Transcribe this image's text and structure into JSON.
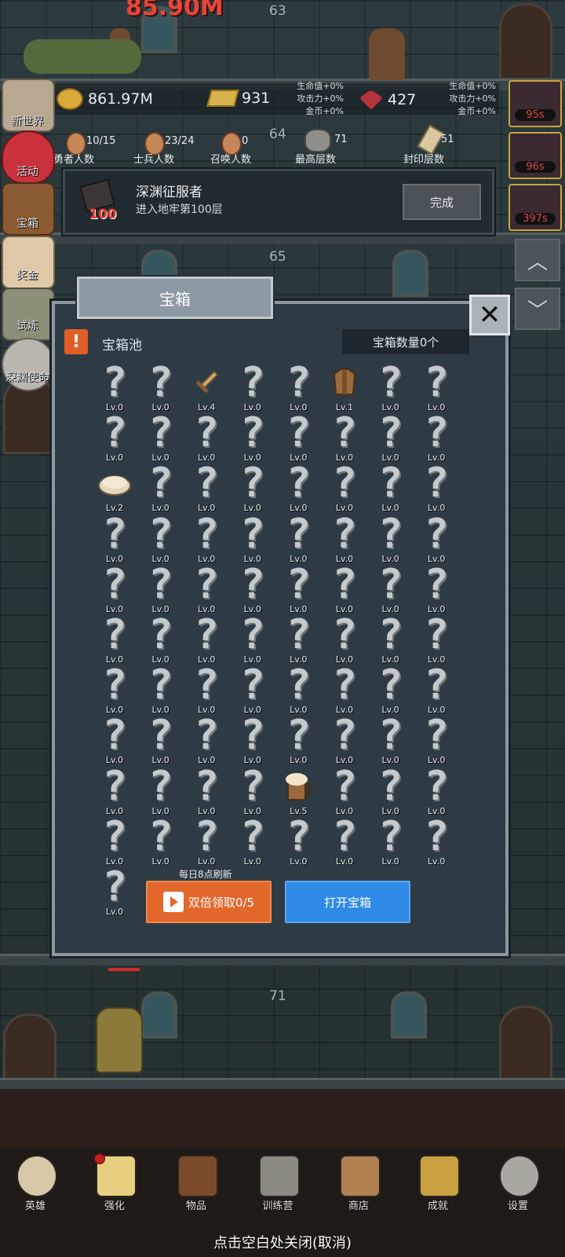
{
  "top_banner": {
    "damage_text": "85.90M"
  },
  "floors": [
    "63",
    "64",
    "65",
    "71"
  ],
  "resources": {
    "gold": "861.97M",
    "gold_bar": "931",
    "gem": "427",
    "bonus_left": [
      "生命值+0%",
      "攻击力+0%",
      "金币+0%"
    ],
    "bonus_right": [
      "生命值+0%",
      "攻击力+0%",
      "金币+0%"
    ]
  },
  "timers": [
    "95s",
    "96s",
    "397s"
  ],
  "stats": [
    {
      "value": "10/15",
      "label": "勇者人数"
    },
    {
      "value": "23/24",
      "label": "士兵人数"
    },
    {
      "value": "0",
      "label": "召唤人数"
    },
    {
      "value": "71",
      "label": "最高层数"
    },
    {
      "value": "51",
      "label": "封印层数"
    }
  ],
  "side_menu": [
    "新世界",
    "活动",
    "宝箱",
    "奖金",
    "试炼",
    "深渊使命"
  ],
  "quest": {
    "level_badge": "100",
    "title": "深渊征服者",
    "desc": "进入地牢第100层",
    "button": "完成"
  },
  "panel": {
    "title": "宝箱",
    "pool_label": "宝箱池",
    "count_label": "宝箱数量0个",
    "close_icon": "close-x-icon",
    "refresh_note": "每日8点刷新",
    "double_button": "双倍领取0/5",
    "open_button": "打开宝箱",
    "items": [
      {
        "lv": "Lv.0",
        "icon": "unknown"
      },
      {
        "lv": "Lv.0",
        "icon": "unknown"
      },
      {
        "lv": "Lv.4",
        "icon": "sword"
      },
      {
        "lv": "Lv.0",
        "icon": "unknown"
      },
      {
        "lv": "Lv.0",
        "icon": "unknown"
      },
      {
        "lv": "Lv.1",
        "icon": "armor"
      },
      {
        "lv": "Lv.0",
        "icon": "unknown"
      },
      {
        "lv": "Lv.0",
        "icon": "unknown"
      },
      {
        "lv": "Lv.0",
        "icon": "unknown"
      },
      {
        "lv": "Lv.0",
        "icon": "unknown"
      },
      {
        "lv": "Lv.0",
        "icon": "unknown"
      },
      {
        "lv": "Lv.0",
        "icon": "unknown"
      },
      {
        "lv": "Lv.0",
        "icon": "unknown"
      },
      {
        "lv": "Lv.0",
        "icon": "unknown"
      },
      {
        "lv": "Lv.0",
        "icon": "unknown"
      },
      {
        "lv": "Lv.0",
        "icon": "unknown"
      },
      {
        "lv": "Lv.2",
        "icon": "bread"
      },
      {
        "lv": "Lv.0",
        "icon": "unknown"
      },
      {
        "lv": "Lv.0",
        "icon": "unknown"
      },
      {
        "lv": "Lv.0",
        "icon": "unknown"
      },
      {
        "lv": "Lv.0",
        "icon": "unknown"
      },
      {
        "lv": "Lv.0",
        "icon": "unknown"
      },
      {
        "lv": "Lv.0",
        "icon": "unknown"
      },
      {
        "lv": "Lv.0",
        "icon": "unknown"
      },
      {
        "lv": "Lv.0",
        "icon": "unknown"
      },
      {
        "lv": "Lv.0",
        "icon": "unknown"
      },
      {
        "lv": "Lv.0",
        "icon": "unknown"
      },
      {
        "lv": "Lv.0",
        "icon": "unknown"
      },
      {
        "lv": "Lv.0",
        "icon": "unknown"
      },
      {
        "lv": "Lv.0",
        "icon": "unknown"
      },
      {
        "lv": "Lv.0",
        "icon": "unknown"
      },
      {
        "lv": "Lv.0",
        "icon": "unknown"
      },
      {
        "lv": "Lv.0",
        "icon": "unknown"
      },
      {
        "lv": "Lv.0",
        "icon": "unknown"
      },
      {
        "lv": "Lv.0",
        "icon": "unknown"
      },
      {
        "lv": "Lv.0",
        "icon": "unknown"
      },
      {
        "lv": "Lv.0",
        "icon": "unknown"
      },
      {
        "lv": "Lv.0",
        "icon": "unknown"
      },
      {
        "lv": "Lv.0",
        "icon": "unknown"
      },
      {
        "lv": "Lv.0",
        "icon": "unknown"
      },
      {
        "lv": "Lv.0",
        "icon": "unknown"
      },
      {
        "lv": "Lv.0",
        "icon": "unknown"
      },
      {
        "lv": "Lv.0",
        "icon": "unknown"
      },
      {
        "lv": "Lv.0",
        "icon": "unknown"
      },
      {
        "lv": "Lv.0",
        "icon": "unknown"
      },
      {
        "lv": "Lv.0",
        "icon": "unknown"
      },
      {
        "lv": "Lv.0",
        "icon": "unknown"
      },
      {
        "lv": "Lv.0",
        "icon": "unknown"
      },
      {
        "lv": "Lv.0",
        "icon": "unknown"
      },
      {
        "lv": "Lv.0",
        "icon": "unknown"
      },
      {
        "lv": "Lv.0",
        "icon": "unknown"
      },
      {
        "lv": "Lv.0",
        "icon": "unknown"
      },
      {
        "lv": "Lv.0",
        "icon": "unknown"
      },
      {
        "lv": "Lv.0",
        "icon": "unknown"
      },
      {
        "lv": "Lv.0",
        "icon": "unknown"
      },
      {
        "lv": "Lv.0",
        "icon": "unknown"
      },
      {
        "lv": "Lv.0",
        "icon": "unknown"
      },
      {
        "lv": "Lv.0",
        "icon": "unknown"
      },
      {
        "lv": "Lv.0",
        "icon": "unknown"
      },
      {
        "lv": "Lv.0",
        "icon": "unknown"
      },
      {
        "lv": "Lv.0",
        "icon": "unknown"
      },
      {
        "lv": "Lv.0",
        "icon": "unknown"
      },
      {
        "lv": "Lv.0",
        "icon": "unknown"
      },
      {
        "lv": "Lv.0",
        "icon": "unknown"
      },
      {
        "lv": "Lv.0",
        "icon": "unknown"
      },
      {
        "lv": "Lv.0",
        "icon": "unknown"
      },
      {
        "lv": "Lv.0",
        "icon": "unknown"
      },
      {
        "lv": "Lv.0",
        "icon": "unknown"
      },
      {
        "lv": "Lv.5",
        "icon": "mug"
      },
      {
        "lv": "Lv.0",
        "icon": "unknown"
      },
      {
        "lv": "Lv.0",
        "icon": "unknown"
      },
      {
        "lv": "Lv.0",
        "icon": "unknown"
      },
      {
        "lv": "Lv.0",
        "icon": "unknown"
      },
      {
        "lv": "Lv.0",
        "icon": "unknown"
      },
      {
        "lv": "Lv.0",
        "icon": "unknown"
      },
      {
        "lv": "Lv.0",
        "icon": "unknown"
      },
      {
        "lv": "Lv.0",
        "icon": "unknown"
      },
      {
        "lv": "Lv.0",
        "icon": "unknown"
      },
      {
        "lv": "Lv.0",
        "icon": "unknown"
      },
      {
        "lv": "Lv.0",
        "icon": "unknown"
      },
      {
        "lv": "Lv.0",
        "icon": "unknown"
      }
    ]
  },
  "bottom_nav": [
    {
      "label": "英雄",
      "icon": "skull-icon",
      "dot": false
    },
    {
      "label": "强化",
      "icon": "candle-icon",
      "dot": true
    },
    {
      "label": "物品",
      "icon": "book-icon",
      "dot": false
    },
    {
      "label": "训练营",
      "icon": "lantern-icon",
      "dot": false
    },
    {
      "label": "商店",
      "icon": "mug-icon",
      "dot": false
    },
    {
      "label": "成就",
      "icon": "key-icon",
      "dot": false
    },
    {
      "label": "设置",
      "icon": "gear-icon",
      "dot": false
    }
  ],
  "close_hint": "点击空白处关闭(取消)"
}
